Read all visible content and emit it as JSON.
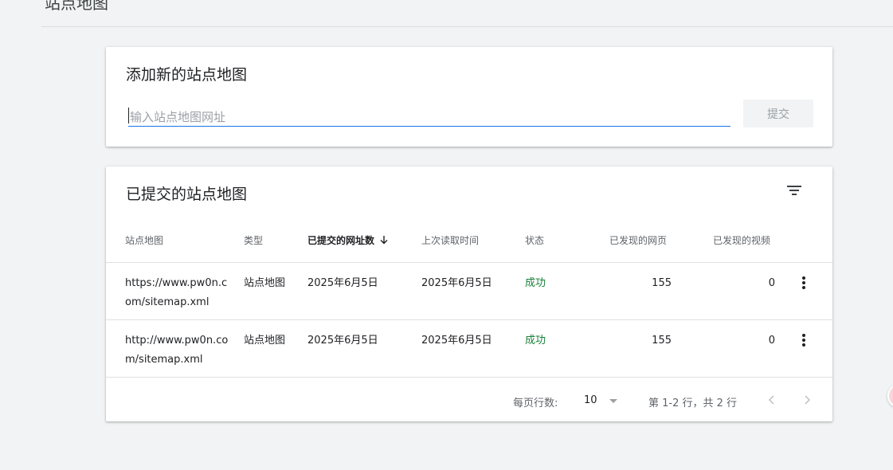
{
  "header": {
    "title": "站点地图"
  },
  "add_card": {
    "title": "添加新的站点地图",
    "input_placeholder": "输入站点地图网址",
    "submit_label": "提交"
  },
  "list_card": {
    "title": "已提交的站点地图",
    "filter_icon": "filter-icon",
    "columns": {
      "sitemap": "站点地图",
      "type": "类型",
      "submitted": "已提交的网址数",
      "last_read": "上次读取时间",
      "status": "状态",
      "pages": "已发现的网页",
      "videos": "已发现的视频"
    },
    "sort_icon": "arrow-down-icon",
    "rows": [
      {
        "sitemap": "https://www.pw0n.com/sitemap.xml",
        "type": "站点地图",
        "submitted": "2025年6月5日",
        "last_read": "2025年6月5日",
        "status": "成功",
        "pages": "155",
        "videos": "0"
      },
      {
        "sitemap": "http://www.pw0n.com/sitemap.xml",
        "type": "站点地图",
        "submitted": "2025年6月5日",
        "last_read": "2025年6月5日",
        "status": "成功",
        "pages": "155",
        "videos": "0"
      }
    ],
    "pagination": {
      "rows_per_page_label": "每页行数:",
      "rows_per_page": "10",
      "range_text": "第 1-2 行，共 2 行"
    }
  },
  "colors": {
    "accent": "#1a73e8",
    "success": "#188038",
    "background": "#f1f3f4"
  }
}
